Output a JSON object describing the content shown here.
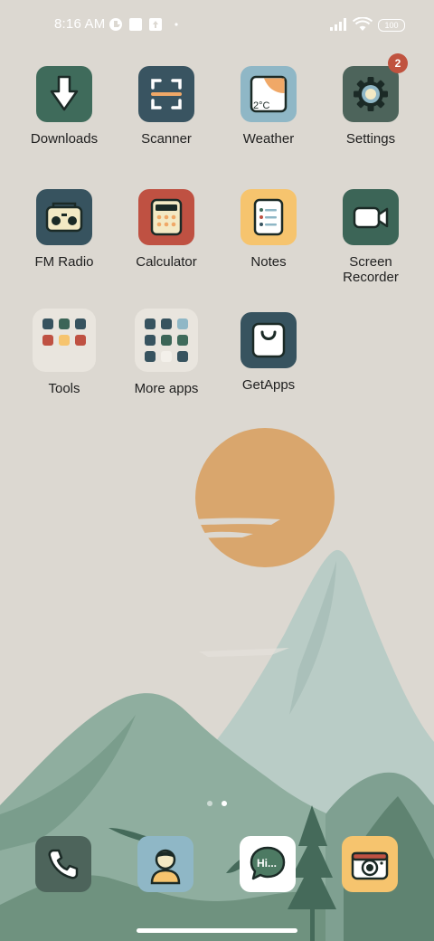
{
  "status_bar": {
    "time": "8:16 AM",
    "battery": "100",
    "icons": [
      "cat-icon",
      "square-notification-icon",
      "upload-notification-icon",
      "dot-icon",
      "signal-icon",
      "wifi-icon",
      "battery-icon"
    ]
  },
  "apps": [
    {
      "label": "Downloads",
      "icon": "download-arrow-icon",
      "color": "#3f6b5b"
    },
    {
      "label": "Scanner",
      "icon": "scan-frame-icon",
      "color": "#395461"
    },
    {
      "label": "Weather",
      "icon": "weather-icon",
      "color": "#8fb7c6",
      "icon_text": "2°C"
    },
    {
      "label": "Settings",
      "icon": "gear-icon",
      "color": "#4d645b",
      "badge": "2"
    },
    {
      "label": "FM Radio",
      "icon": "radio-icon",
      "color": "#37535f"
    },
    {
      "label": "Calculator",
      "icon": "calculator-icon",
      "color": "#bf5142"
    },
    {
      "label": "Notes",
      "icon": "notes-icon",
      "color": "#f6c46e"
    },
    {
      "label": "Screen\nRecorder",
      "label_line1": "Screen",
      "label_line2": "Recorder",
      "icon": "video-camera-icon",
      "color": "#3c6557"
    },
    {
      "label": "Tools",
      "icon": "folder-icon"
    },
    {
      "label": "More apps",
      "icon": "folder-icon"
    },
    {
      "label": "GetApps",
      "icon": "shopping-bag-icon",
      "color": "#37535f"
    }
  ],
  "dock": [
    {
      "name": "phone",
      "icon": "phone-icon",
      "color": "#4d645b"
    },
    {
      "name": "contacts",
      "icon": "person-icon",
      "color": "#8fb7c6"
    },
    {
      "name": "messaging",
      "icon": "chat-bubble-icon",
      "color": "#ffffff",
      "icon_text": "Hi..."
    },
    {
      "name": "camera",
      "icon": "camera-icon",
      "color": "#f6c46e"
    }
  ],
  "page_indicator": {
    "pages": 2,
    "current": 2
  }
}
